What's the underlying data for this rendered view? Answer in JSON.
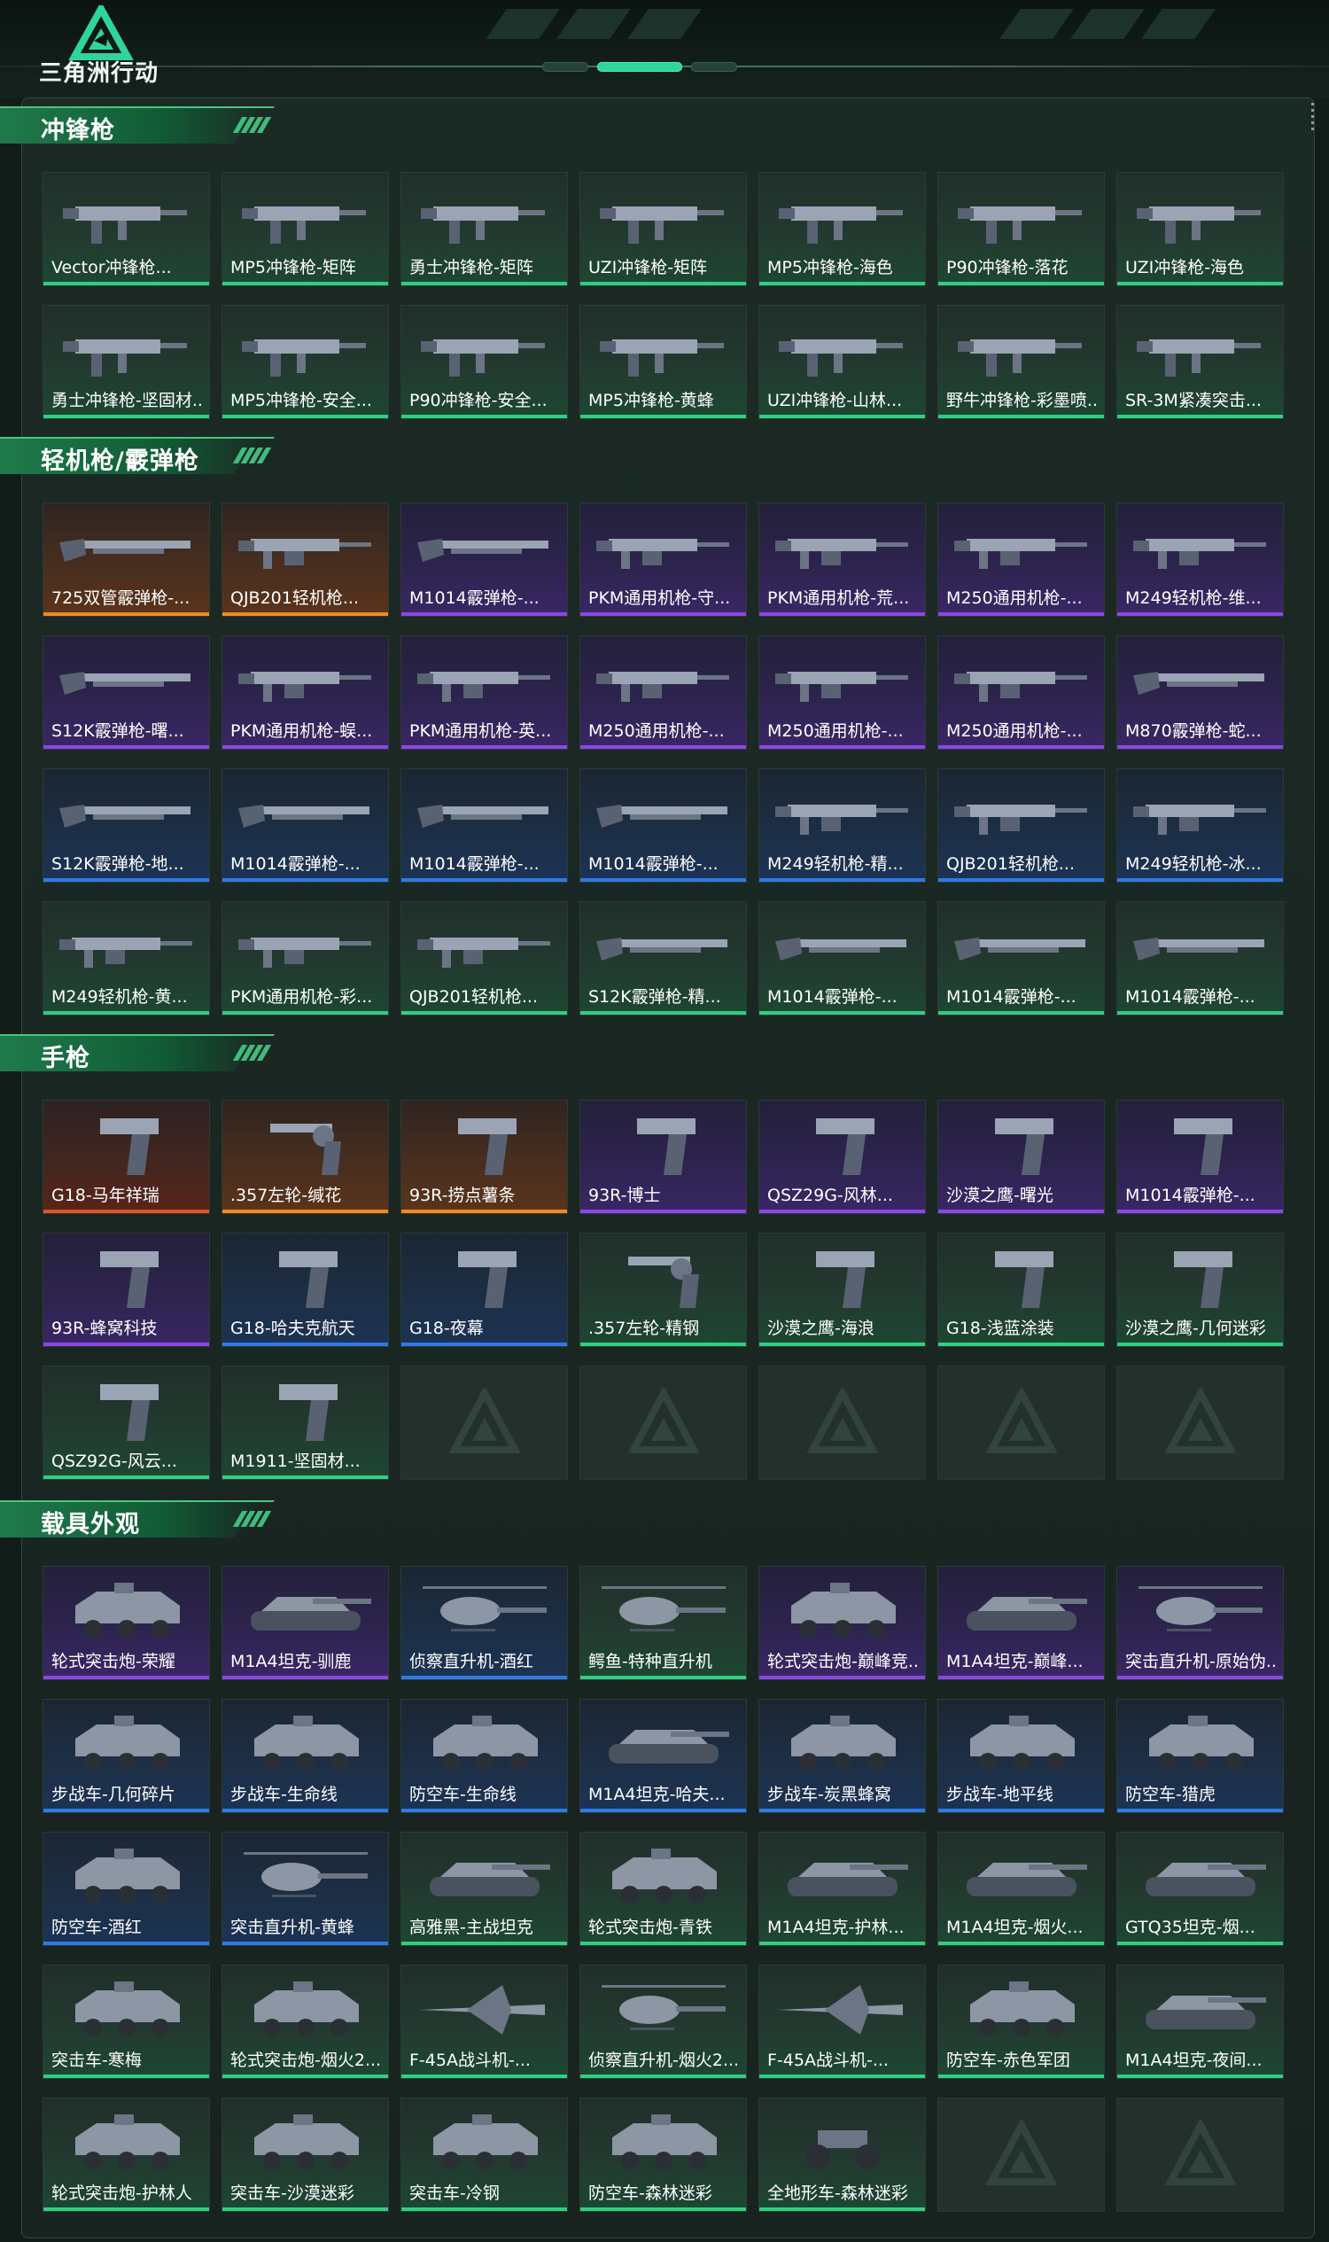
{
  "app": {
    "title": "三角洲行动"
  },
  "colors": {
    "rarity_green": "#2fd080",
    "rarity_blue": "#2f7ae6",
    "rarity_purple": "#8d45e6",
    "rarity_orange": "#f08a22",
    "rarity_red": "#e0532a",
    "section_header": "#1f7a4b"
  },
  "sections": [
    {
      "title": "冲锋枪",
      "items": [
        {
          "label": "Vector冲锋枪...",
          "rarity": "green",
          "icon": "smg-icon"
        },
        {
          "label": "MP5冲锋枪-矩阵",
          "rarity": "green",
          "icon": "smg-icon"
        },
        {
          "label": "勇士冲锋枪-矩阵",
          "rarity": "green",
          "icon": "smg-icon"
        },
        {
          "label": "UZI冲锋枪-矩阵",
          "rarity": "green",
          "icon": "smg-icon"
        },
        {
          "label": "MP5冲锋枪-海色",
          "rarity": "green",
          "icon": "smg-icon"
        },
        {
          "label": "P90冲锋枪-落花",
          "rarity": "green",
          "icon": "smg-icon"
        },
        {
          "label": "UZI冲锋枪-海色",
          "rarity": "green",
          "icon": "smg-icon"
        },
        {
          "label": "勇士冲锋枪-坚固材...",
          "rarity": "green",
          "icon": "smg-icon"
        },
        {
          "label": "MP5冲锋枪-安全...",
          "rarity": "green",
          "icon": "smg-icon"
        },
        {
          "label": "P90冲锋枪-安全...",
          "rarity": "green",
          "icon": "smg-icon"
        },
        {
          "label": "MP5冲锋枪-黄蜂",
          "rarity": "green",
          "icon": "smg-icon"
        },
        {
          "label": "UZI冲锋枪-山林...",
          "rarity": "green",
          "icon": "smg-icon"
        },
        {
          "label": "野牛冲锋枪-彩墨喷...",
          "rarity": "green",
          "icon": "smg-icon"
        },
        {
          "label": "SR-3M紧凑突击...",
          "rarity": "green",
          "icon": "smg-icon"
        }
      ]
    },
    {
      "title": "轻机枪/霰弹枪",
      "items": [
        {
          "label": "725双管霰弹枪-...",
          "rarity": "orange",
          "icon": "shotgun-icon"
        },
        {
          "label": "QJB201轻机枪...",
          "rarity": "orange",
          "icon": "lmg-icon"
        },
        {
          "label": "M1014霰弹枪-...",
          "rarity": "purple",
          "icon": "shotgun-icon"
        },
        {
          "label": "PKM通用机枪-守...",
          "rarity": "purple",
          "icon": "lmg-icon"
        },
        {
          "label": "PKM通用机枪-荒...",
          "rarity": "purple",
          "icon": "lmg-icon"
        },
        {
          "label": "M250通用机枪-...",
          "rarity": "purple",
          "icon": "lmg-icon"
        },
        {
          "label": "M249轻机枪-维...",
          "rarity": "purple",
          "icon": "lmg-icon"
        },
        {
          "label": "S12K霰弹枪-曙...",
          "rarity": "purple",
          "icon": "shotgun-icon"
        },
        {
          "label": "PKM通用机枪-蜈...",
          "rarity": "purple",
          "icon": "lmg-icon"
        },
        {
          "label": "PKM通用机枪-英...",
          "rarity": "purple",
          "icon": "lmg-icon"
        },
        {
          "label": "M250通用机枪-...",
          "rarity": "purple",
          "icon": "lmg-icon"
        },
        {
          "label": "M250通用机枪-...",
          "rarity": "purple",
          "icon": "lmg-icon"
        },
        {
          "label": "M250通用机枪-...",
          "rarity": "purple",
          "icon": "lmg-icon"
        },
        {
          "label": "M870霰弹枪-蛇...",
          "rarity": "purple",
          "icon": "shotgun-icon"
        },
        {
          "label": "S12K霰弹枪-地...",
          "rarity": "blue",
          "icon": "shotgun-icon"
        },
        {
          "label": "M1014霰弹枪-...",
          "rarity": "blue",
          "icon": "shotgun-icon"
        },
        {
          "label": "M1014霰弹枪-...",
          "rarity": "blue",
          "icon": "shotgun-icon"
        },
        {
          "label": "M1014霰弹枪-...",
          "rarity": "blue",
          "icon": "shotgun-icon"
        },
        {
          "label": "M249轻机枪-精...",
          "rarity": "blue",
          "icon": "lmg-icon"
        },
        {
          "label": "QJB201轻机枪...",
          "rarity": "blue",
          "icon": "lmg-icon"
        },
        {
          "label": "M249轻机枪-冰...",
          "rarity": "blue",
          "icon": "lmg-icon"
        },
        {
          "label": "M249轻机枪-黄...",
          "rarity": "green",
          "icon": "lmg-icon"
        },
        {
          "label": "PKM通用机枪-彩...",
          "rarity": "green",
          "icon": "lmg-icon"
        },
        {
          "label": "QJB201轻机枪...",
          "rarity": "green",
          "icon": "lmg-icon"
        },
        {
          "label": "S12K霰弹枪-精...",
          "rarity": "green",
          "icon": "shotgun-icon"
        },
        {
          "label": "M1014霰弹枪-...",
          "rarity": "green",
          "icon": "shotgun-icon"
        },
        {
          "label": "M1014霰弹枪-...",
          "rarity": "green",
          "icon": "shotgun-icon"
        },
        {
          "label": "M1014霰弹枪-...",
          "rarity": "green",
          "icon": "shotgun-icon"
        }
      ]
    },
    {
      "title": "手枪",
      "items": [
        {
          "label": "G18-马年祥瑞",
          "rarity": "red",
          "icon": "pistol-icon"
        },
        {
          "label": ".357左轮-缄花",
          "rarity": "orange",
          "icon": "revolver-icon"
        },
        {
          "label": "93R-捞点薯条",
          "rarity": "orange",
          "icon": "pistol-icon"
        },
        {
          "label": "93R-博士",
          "rarity": "purple",
          "icon": "pistol-icon"
        },
        {
          "label": "QSZ29G-风林...",
          "rarity": "purple",
          "icon": "pistol-icon"
        },
        {
          "label": "沙漠之鹰-曙光",
          "rarity": "purple",
          "icon": "pistol-icon"
        },
        {
          "label": "M1014霰弹枪-...",
          "rarity": "purple",
          "icon": "pistol-icon"
        },
        {
          "label": "93R-蜂窝科技",
          "rarity": "purple",
          "icon": "pistol-icon"
        },
        {
          "label": "G18-哈夫克航天",
          "rarity": "blue",
          "icon": "pistol-icon"
        },
        {
          "label": "G18-夜幕",
          "rarity": "blue",
          "icon": "pistol-icon"
        },
        {
          "label": ".357左轮-精钢",
          "rarity": "green",
          "icon": "revolver-icon"
        },
        {
          "label": "沙漠之鹰-海浪",
          "rarity": "green",
          "icon": "pistol-icon"
        },
        {
          "label": "G18-浅蓝涂装",
          "rarity": "green",
          "icon": "pistol-icon"
        },
        {
          "label": "沙漠之鹰-几何迷彩",
          "rarity": "green",
          "icon": "pistol-icon"
        },
        {
          "label": "QSZ92G-风云...",
          "rarity": "green",
          "icon": "pistol-icon"
        },
        {
          "label": "M1911-坚固材...",
          "rarity": "green",
          "icon": "pistol-icon"
        },
        {
          "label": "",
          "rarity": "empty",
          "icon": "delta-logo-icon"
        },
        {
          "label": "",
          "rarity": "empty",
          "icon": "delta-logo-icon"
        },
        {
          "label": "",
          "rarity": "empty",
          "icon": "delta-logo-icon"
        },
        {
          "label": "",
          "rarity": "empty",
          "icon": "delta-logo-icon"
        },
        {
          "label": "",
          "rarity": "empty",
          "icon": "delta-logo-icon"
        }
      ]
    },
    {
      "title": "载具外观",
      "items": [
        {
          "label": "轮式突击炮-荣耀",
          "rarity": "purple",
          "icon": "vehicle-icon"
        },
        {
          "label": "M1A4坦克-驯鹿",
          "rarity": "purple",
          "icon": "tank-icon"
        },
        {
          "label": "侦察直升机-酒红",
          "rarity": "blue",
          "icon": "helicopter-icon"
        },
        {
          "label": "鳄鱼-特种直升机",
          "rarity": "green",
          "icon": "helicopter-icon"
        },
        {
          "label": "轮式突击炮-巅峰竞...",
          "rarity": "purple",
          "icon": "vehicle-icon"
        },
        {
          "label": "M1A4坦克-巅峰...",
          "rarity": "purple",
          "icon": "tank-icon"
        },
        {
          "label": "突击直升机-原始伪...",
          "rarity": "purple",
          "icon": "helicopter-icon"
        },
        {
          "label": "步战车-几何碎片",
          "rarity": "blue",
          "icon": "vehicle-icon"
        },
        {
          "label": "步战车-生命线",
          "rarity": "blue",
          "icon": "vehicle-icon"
        },
        {
          "label": "防空车-生命线",
          "rarity": "blue",
          "icon": "vehicle-icon"
        },
        {
          "label": "M1A4坦克-哈夫...",
          "rarity": "blue",
          "icon": "tank-icon"
        },
        {
          "label": "步战车-炭黑蜂窝",
          "rarity": "blue",
          "icon": "vehicle-icon"
        },
        {
          "label": "步战车-地平线",
          "rarity": "blue",
          "icon": "vehicle-icon"
        },
        {
          "label": "防空车-猎虎",
          "rarity": "blue",
          "icon": "vehicle-icon"
        },
        {
          "label": "防空车-酒红",
          "rarity": "blue",
          "icon": "vehicle-icon"
        },
        {
          "label": "突击直升机-黄蜂",
          "rarity": "blue",
          "icon": "helicopter-icon"
        },
        {
          "label": "高雅黑-主战坦克",
          "rarity": "green",
          "icon": "tank-icon"
        },
        {
          "label": "轮式突击炮-青铁",
          "rarity": "green",
          "icon": "vehicle-icon"
        },
        {
          "label": "M1A4坦克-护林...",
          "rarity": "green",
          "icon": "tank-icon"
        },
        {
          "label": "M1A4坦克-烟火...",
          "rarity": "green",
          "icon": "tank-icon"
        },
        {
          "label": "GTQ35坦克-烟...",
          "rarity": "green",
          "icon": "tank-icon"
        },
        {
          "label": "突击车-寒梅",
          "rarity": "green",
          "icon": "vehicle-icon"
        },
        {
          "label": "轮式突击炮-烟火2...",
          "rarity": "green",
          "icon": "vehicle-icon"
        },
        {
          "label": "F-45A战斗机-...",
          "rarity": "green",
          "icon": "jet-icon"
        },
        {
          "label": "侦察直升机-烟火2...",
          "rarity": "green",
          "icon": "helicopter-icon"
        },
        {
          "label": "F-45A战斗机-...",
          "rarity": "green",
          "icon": "jet-icon"
        },
        {
          "label": "防空车-赤色军团",
          "rarity": "green",
          "icon": "vehicle-icon"
        },
        {
          "label": "M1A4坦克-夜间...",
          "rarity": "green",
          "icon": "tank-icon"
        },
        {
          "label": "轮式突击炮-护林人",
          "rarity": "green",
          "icon": "vehicle-icon"
        },
        {
          "label": "突击车-沙漠迷彩",
          "rarity": "green",
          "icon": "vehicle-icon"
        },
        {
          "label": "突击车-冷钢",
          "rarity": "green",
          "icon": "vehicle-icon"
        },
        {
          "label": "防空车-森林迷彩",
          "rarity": "green",
          "icon": "vehicle-icon"
        },
        {
          "label": "全地形车-森林迷彩",
          "rarity": "green",
          "icon": "atv-icon"
        },
        {
          "label": "",
          "rarity": "empty",
          "icon": "delta-logo-icon"
        },
        {
          "label": "",
          "rarity": "empty",
          "icon": "delta-logo-icon"
        }
      ]
    }
  ]
}
